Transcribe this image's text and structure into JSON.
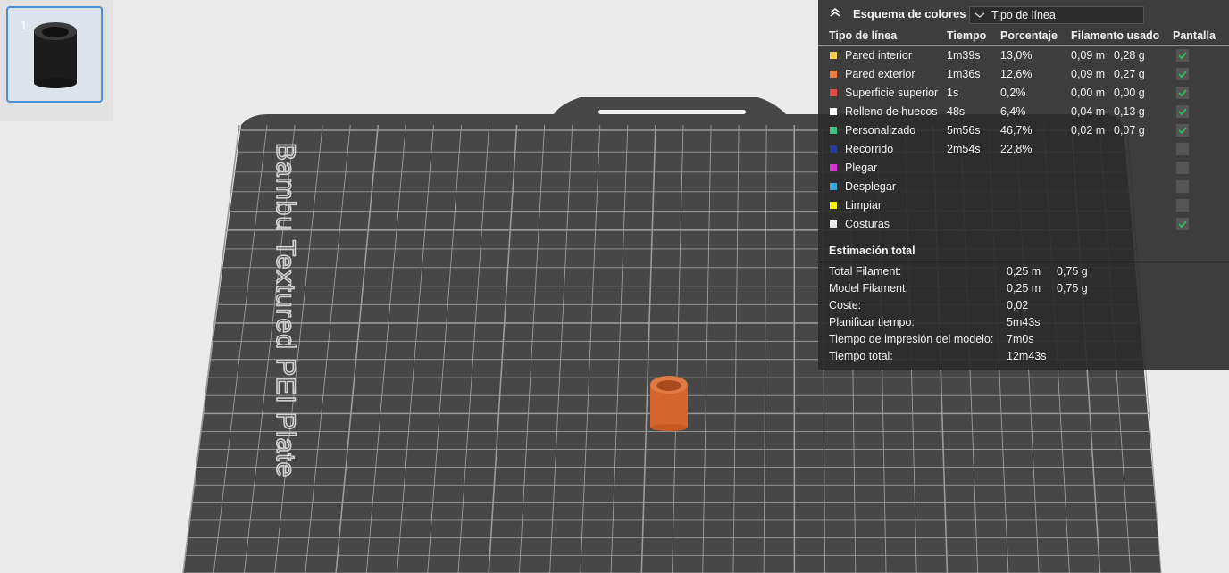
{
  "thumbnail": {
    "index": "1"
  },
  "plate": {
    "label": "Bambu Textured PEI Plate",
    "plate_color": "#474747",
    "grid_color": "#9a9a9a",
    "model_color": "#d4662d"
  },
  "panel": {
    "title": "Esquema de colores",
    "scheme_value": "Tipo de línea",
    "columns": [
      "Tipo de línea",
      "Tiempo",
      "Porcentaje",
      "Filamento usado",
      "Pantalla"
    ],
    "rows": [
      {
        "name": "Pared interior",
        "color": "#f2d04e",
        "time": "1m39s",
        "percent": "13,0%",
        "length": "0,09 m",
        "weight": "0,28 g",
        "checked": true
      },
      {
        "name": "Pared exterior",
        "color": "#ee7a3c",
        "time": "1m36s",
        "percent": "12,6%",
        "length": "0,09 m",
        "weight": "0,27 g",
        "checked": true
      },
      {
        "name": "Superficie superior",
        "color": "#e24848",
        "time": "1s",
        "percent": "0,2%",
        "length": "0,00 m",
        "weight": "0,00 g",
        "checked": true
      },
      {
        "name": "Relleno de huecos",
        "color": "#ffffff",
        "time": "48s",
        "percent": "6,4%",
        "length": "0,04 m",
        "weight": "0,13 g",
        "checked": true
      },
      {
        "name": "Personalizado",
        "color": "#3fbf7f",
        "time": "5m56s",
        "percent": "46,7%",
        "length": "0,02 m",
        "weight": "0,07 g",
        "checked": true
      },
      {
        "name": "Recorrido",
        "color": "#2a3c96",
        "time": "2m54s",
        "percent": "22,8%",
        "length": "",
        "weight": "",
        "checked": false
      },
      {
        "name": "Plegar",
        "color": "#d633d0",
        "time": "",
        "percent": "",
        "length": "",
        "weight": "",
        "checked": false
      },
      {
        "name": "Desplegar",
        "color": "#3aa5d6",
        "time": "",
        "percent": "",
        "length": "",
        "weight": "",
        "checked": false
      },
      {
        "name": "Limpiar",
        "color": "#f5f500",
        "time": "",
        "percent": "",
        "length": "",
        "weight": "",
        "checked": false
      },
      {
        "name": "Costuras",
        "color": "#e8e8e8",
        "time": "",
        "percent": "",
        "length": "",
        "weight": "",
        "checked": true
      }
    ],
    "summary_title": "Estimación total",
    "summary": [
      {
        "label": "Total Filament:",
        "value": "0,25 m",
        "value2": "0,75 g"
      },
      {
        "label": "Model Filament:",
        "value": "0,25 m",
        "value2": "0,75 g"
      },
      {
        "label": "Coste:",
        "value": "0,02",
        "value2": ""
      },
      {
        "label": "Planificar tiempo:",
        "value": "5m43s",
        "value2": ""
      },
      {
        "label": "Tiempo de impresión del modelo:",
        "value": "7m0s",
        "value2": ""
      },
      {
        "label": "Tiempo total:",
        "value": "12m43s",
        "value2": ""
      }
    ]
  }
}
